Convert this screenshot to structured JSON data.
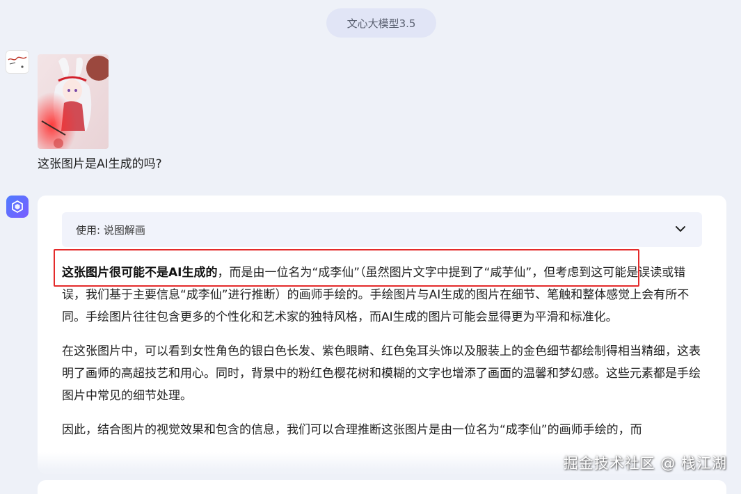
{
  "header": {
    "model_name": "文心大模型3.5"
  },
  "user_message": {
    "question": "这张图片是AI生成的吗?"
  },
  "bot_message": {
    "plugin_label": "使用: 说图解画",
    "paragraphs": [
      {
        "bold": "这张图片很可能不是AI生成的",
        "text": "，而是由一位名为“成李仙”（虽然图片文字中提到了“咸芋仙”，但考虑到这可能是误读或错误，我们基于主要信息“成李仙”进行推断）的画师手绘的。手绘图片与AI生成的图片在细节、笔触和整体感觉上会有所不同。手绘图片往往包含更多的个性化和艺术家的独特风格，而AI生成的图片可能会显得更为平滑和标准化。"
      },
      {
        "text": "在这张图片中，可以看到女性角色的银白色长发、紫色眼睛、红色兔耳头饰以及服装上的金色细节都绘制得相当精细，这表明了画师的高超技艺和用心。同时，背景中的粉红色樱花树和模糊的文字也增添了画面的温馨和梦幻感。这些元素都是手绘图片中常见的细节处理。"
      },
      {
        "text": "因此，结合图片的视觉效果和包含的信息，我们可以合理推断这张图片是由一位名为“成李仙”的画师手绘的，而"
      }
    ]
  },
  "watermark": "掘金技术社区 @ 栈江湖",
  "colors": {
    "background": "#eef1f8",
    "pill": "#e1e5f6",
    "card": "#ffffff",
    "plugin_bar": "#f1f3fb",
    "highlight": "#e42a2a",
    "bot_avatar": "#5b6cff"
  }
}
